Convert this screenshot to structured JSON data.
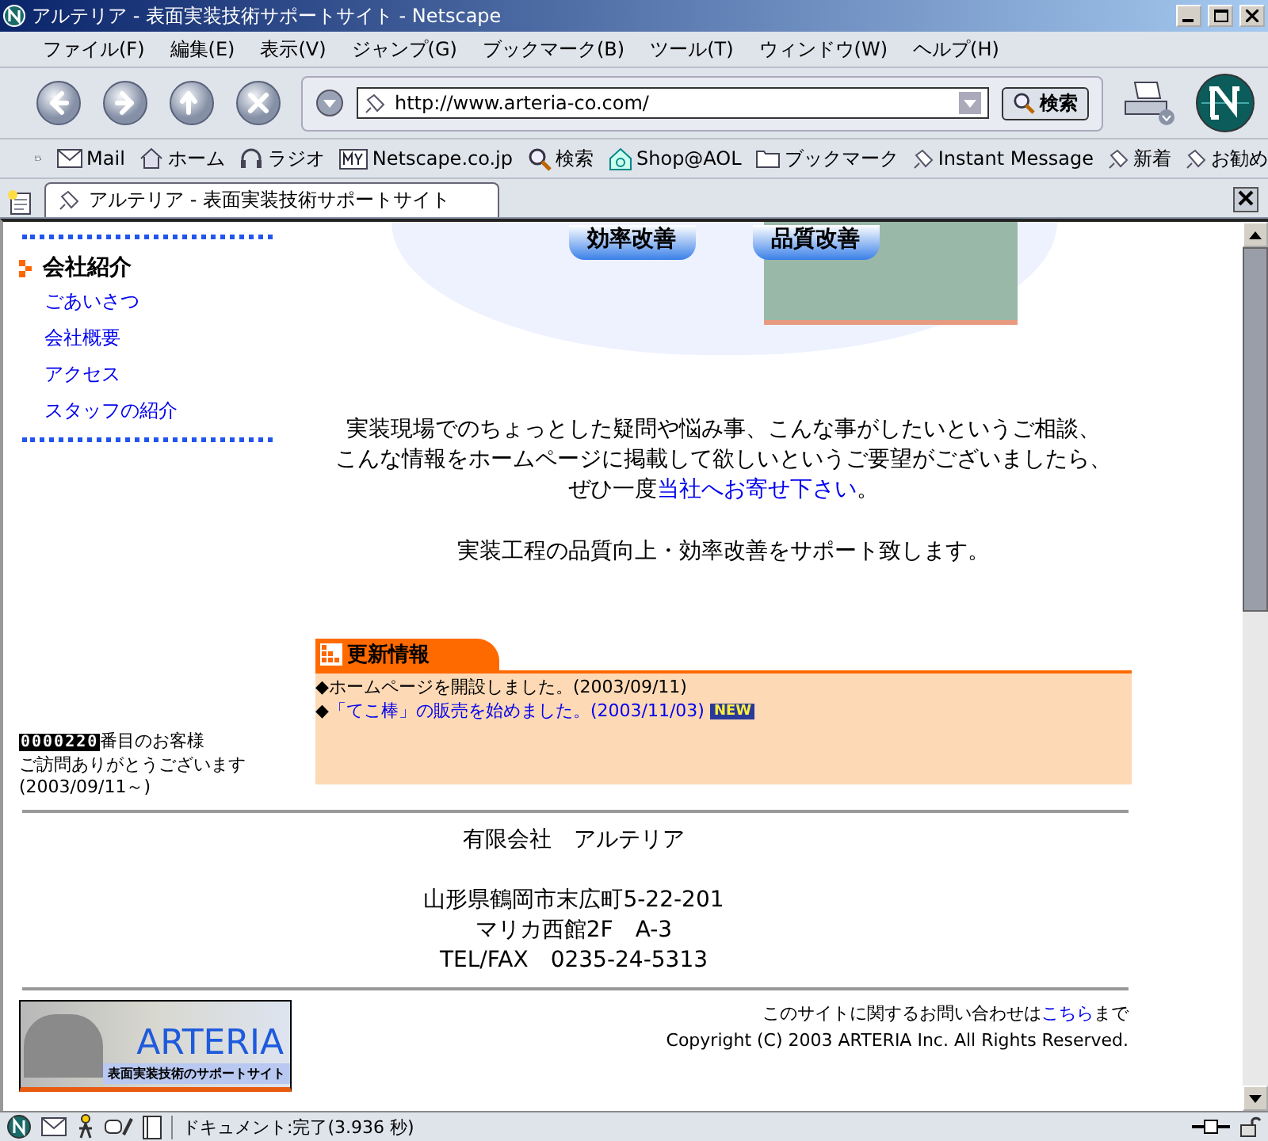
{
  "window": {
    "title": "アルテリア - 表面実装技術サポートサイト - Netscape"
  },
  "menu": [
    "ファイル(F)",
    "編集(E)",
    "表示(V)",
    "ジャンプ(G)",
    "ブックマーク(B)",
    "ツール(T)",
    "ウィンドウ(W)",
    "ヘルプ(H)"
  ],
  "address": {
    "value": "http://www.arteria-co.com/"
  },
  "search_button": "検索",
  "personal_toolbar": [
    {
      "kind": "mail",
      "label": "Mail"
    },
    {
      "kind": "home",
      "label": "ホーム"
    },
    {
      "kind": "radio",
      "label": "ラジオ"
    },
    {
      "kind": "my",
      "label": "Netscape.co.jp"
    },
    {
      "kind": "search",
      "label": "検索"
    },
    {
      "kind": "shop",
      "label": "Shop@AOL"
    },
    {
      "kind": "folder",
      "label": "ブックマーク"
    },
    {
      "kind": "link",
      "label": "Instant Message"
    },
    {
      "kind": "link",
      "label": "新着"
    },
    {
      "kind": "link",
      "label": "お勧め"
    }
  ],
  "tabs": [
    {
      "label": "アルテリア - 表面実装技術サポートサイト",
      "selected": true
    }
  ],
  "page": {
    "banner_buttons": [
      "効率改善",
      "品質改善"
    ],
    "sidebar": {
      "heading": "会社紹介",
      "items": [
        "ごあいさつ",
        "会社概要",
        "アクセス",
        "スタッフの紹介"
      ]
    },
    "intro": {
      "lines": [
        "実装現場でのちょっとした疑問や悩み事、こんな事がしたいというご相談、",
        "こんな情報をホームページに掲載して欲しいというご要望がございましたら、"
      ],
      "before": "ぜひ一度",
      "link": "当社へお寄せ下さい",
      "after": "。"
    },
    "tagline": "実装工程の品質向上・効率改善をサポート致します。",
    "news": {
      "title": "更新情報",
      "items": [
        {
          "bullet": "◆",
          "text": "ホームページを開設しました。(2003/09/11)",
          "link": false
        },
        {
          "bullet": "◆",
          "text": "「てこ棒」の販売を始めました。(2003/11/03)",
          "link": true,
          "badge": "NEW"
        }
      ]
    },
    "counter": {
      "digits": "0000220",
      "suffix": "番目のお客様",
      "lines": [
        "ご訪問ありがとうございます",
        "(2003/09/11～)"
      ]
    },
    "company": {
      "name": "有限会社　アルテリア",
      "address": [
        "山形県鶴岡市末広町5-22-201",
        "マリカ西館2F　A-3",
        "TEL/FAX　0235-24-5313"
      ]
    },
    "contact": {
      "before": "このサイトに関するお問い合わせは",
      "link": "こちら",
      "after": "まで"
    },
    "copyright": "Copyright (C) 2003 ARTERIA Inc. All Rights Reserved.",
    "logo": {
      "name": "ARTERIA",
      "subtitle": "表面実装技術のサポートサイト"
    }
  },
  "status_bar": {
    "text": "ドキュメント:完了(3.936 秒)"
  }
}
